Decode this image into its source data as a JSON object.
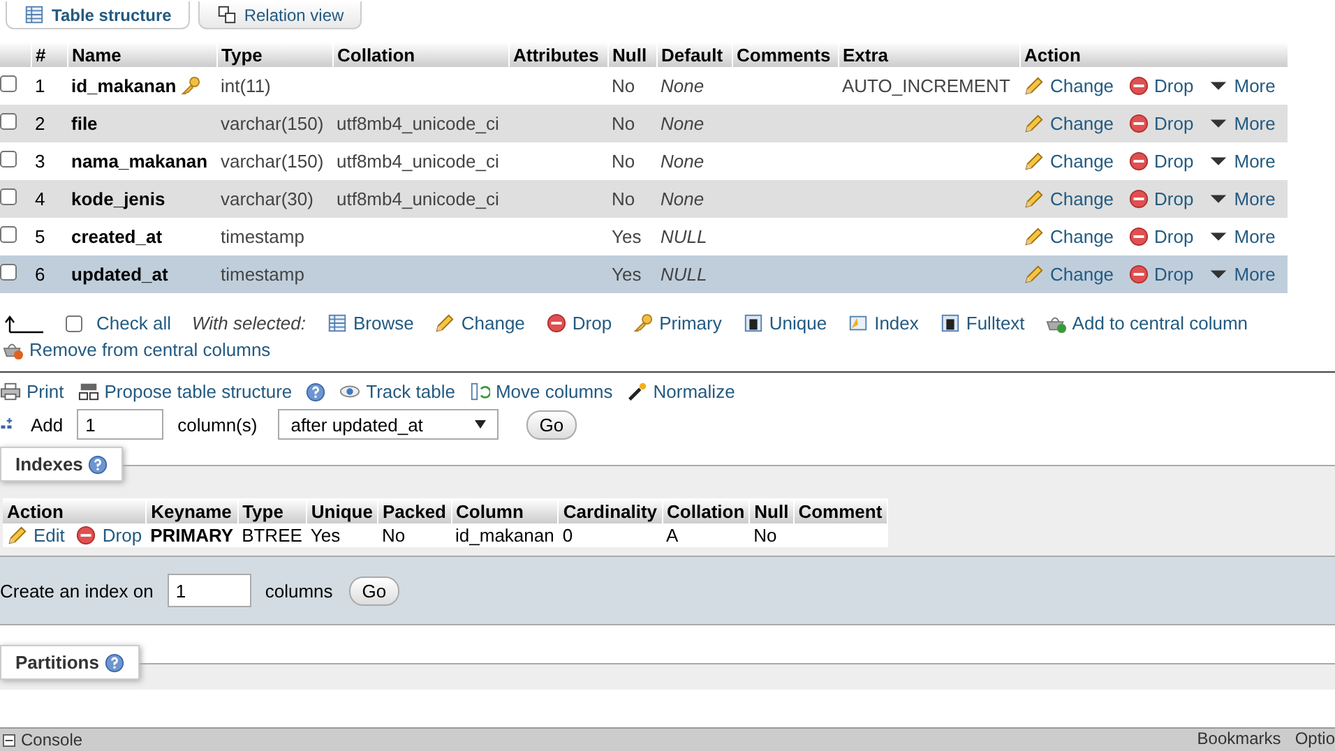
{
  "tabs": [
    {
      "label": "Table structure",
      "kind": "structure",
      "selected": true
    },
    {
      "label": "Relation view",
      "kind": "relation",
      "selected": false
    }
  ],
  "structure": {
    "columns": [
      "#",
      "Name",
      "Type",
      "Collation",
      "Attributes",
      "Null",
      "Default",
      "Comments",
      "Extra",
      "Action"
    ],
    "rows": [
      {
        "num": "1",
        "name": "id_makanan",
        "primary": true,
        "type": "int(11)",
        "null": "No",
        "default": "None",
        "extra": "AUTO_INCREMENT",
        "checked": false,
        "selected": false,
        "actions": [
          {
            "kind": "change",
            "label": "Change"
          },
          {
            "kind": "drop",
            "label": "Drop"
          },
          {
            "kind": "more",
            "label": "More"
          }
        ]
      },
      {
        "num": "2",
        "name": "file",
        "primary": false,
        "type": "varchar(150)",
        "collation": "utf8mb4_unicode_ci",
        "null": "No",
        "default": "None",
        "checked": false,
        "selected": false,
        "actions": [
          {
            "kind": "change",
            "label": "Change"
          },
          {
            "kind": "drop",
            "label": "Drop"
          },
          {
            "kind": "more",
            "label": "More"
          }
        ]
      },
      {
        "num": "3",
        "name": "nama_makanan",
        "primary": false,
        "type": "varchar(150)",
        "collation": "utf8mb4_unicode_ci",
        "null": "No",
        "default": "None",
        "checked": false,
        "selected": false,
        "actions": [
          {
            "kind": "change",
            "label": "Change"
          },
          {
            "kind": "drop",
            "label": "Drop"
          },
          {
            "kind": "more",
            "label": "More"
          }
        ]
      },
      {
        "num": "4",
        "name": "kode_jenis",
        "primary": false,
        "type": "varchar(30)",
        "collation": "utf8mb4_unicode_ci",
        "null": "No",
        "default": "None",
        "checked": false,
        "selected": false,
        "actions": [
          {
            "kind": "change",
            "label": "Change"
          },
          {
            "kind": "drop",
            "label": "Drop"
          },
          {
            "kind": "more",
            "label": "More"
          }
        ]
      },
      {
        "num": "5",
        "name": "created_at",
        "primary": false,
        "type": "timestamp",
        "null": "Yes",
        "default": "NULL",
        "checked": false,
        "selected": false,
        "actions": [
          {
            "kind": "change",
            "label": "Change"
          },
          {
            "kind": "drop",
            "label": "Drop"
          },
          {
            "kind": "more",
            "label": "More"
          }
        ]
      },
      {
        "num": "6",
        "name": "updated_at",
        "primary": false,
        "type": "timestamp",
        "null": "Yes",
        "default": "NULL",
        "checked": false,
        "selected": true,
        "actions": [
          {
            "kind": "change",
            "label": "Change"
          },
          {
            "kind": "drop",
            "label": "Drop"
          },
          {
            "kind": "more",
            "label": "More"
          }
        ]
      }
    ]
  },
  "bulk": {
    "check_all": {
      "label": "Check all",
      "checked": false
    },
    "with_selected": "With selected:",
    "actions": [
      {
        "kind": "browse",
        "label": "Browse"
      },
      {
        "kind": "change",
        "label": "Change"
      },
      {
        "kind": "drop",
        "label": "Drop"
      },
      {
        "kind": "primary",
        "label": "Primary"
      },
      {
        "kind": "unique",
        "label": "Unique"
      },
      {
        "kind": "index",
        "label": "Index"
      },
      {
        "kind": "fulltext",
        "label": "Fulltext"
      },
      {
        "kind": "add_central",
        "label": "Add to central column"
      },
      {
        "kind": "remove_central",
        "label": "Remove from central columns"
      }
    ]
  },
  "tools": [
    {
      "kind": "print",
      "label": "Print"
    },
    {
      "kind": "propose",
      "label": "Propose table structure",
      "help": true
    },
    {
      "kind": "track",
      "label": "Track table"
    },
    {
      "kind": "move",
      "label": "Move columns"
    },
    {
      "kind": "normalize",
      "label": "Normalize"
    }
  ],
  "add_columns": {
    "label": "Add",
    "value": "1",
    "unit": "column(s)",
    "position": "after updated_at",
    "go": "Go"
  },
  "indexes": {
    "legend": "Indexes",
    "columns": [
      "Action",
      "Keyname",
      "Type",
      "Unique",
      "Packed",
      "Column",
      "Cardinality",
      "Collation",
      "Null",
      "Comment"
    ],
    "rows": [
      {
        "actions": [
          {
            "kind": "edit",
            "label": "Edit"
          },
          {
            "kind": "drop",
            "label": "Drop"
          }
        ],
        "keyname": "PRIMARY",
        "type": "BTREE",
        "unique": "Yes",
        "packed": "No",
        "column": "id_makanan",
        "cardinality": "0",
        "collation": "A",
        "null": "No"
      }
    ],
    "create": {
      "label": "Create an index on",
      "value": "1",
      "unit": "columns",
      "go": "Go"
    }
  },
  "partitions": {
    "legend": "Partitions"
  },
  "console": {
    "label": "Console",
    "right": [
      "Bookmarks",
      "Optio"
    ]
  }
}
